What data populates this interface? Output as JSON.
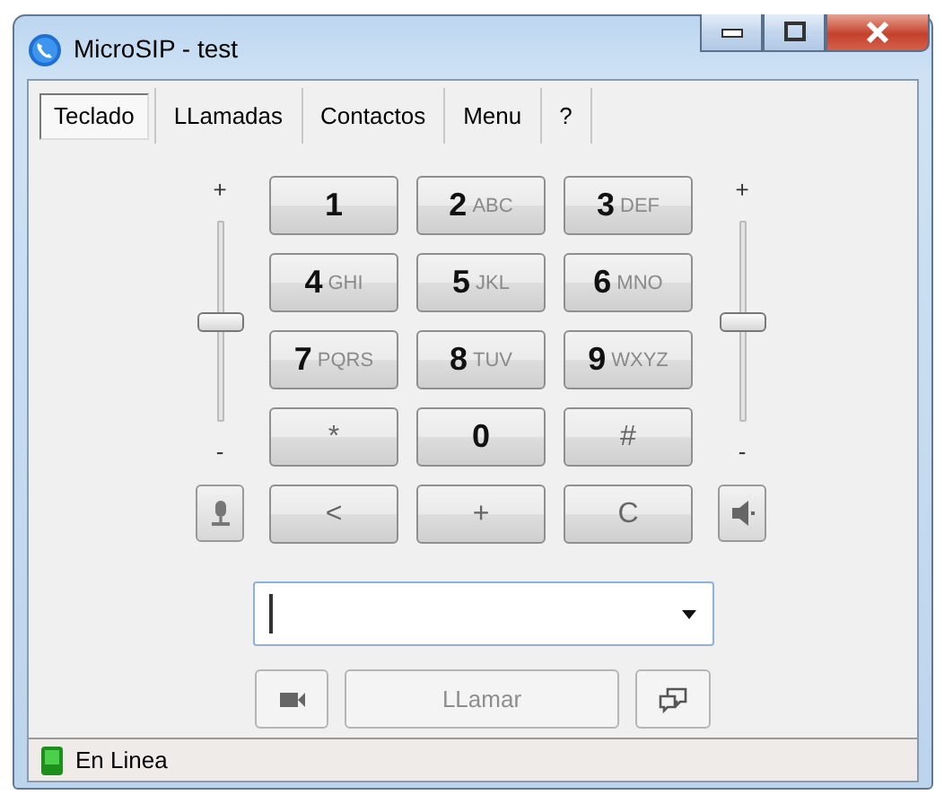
{
  "window": {
    "title": "MicroSIP - test"
  },
  "tabs": [
    {
      "label": "Teclado",
      "selected": true
    },
    {
      "label": "LLamadas",
      "selected": false
    },
    {
      "label": "Contactos",
      "selected": false
    },
    {
      "label": "Menu",
      "selected": false
    },
    {
      "label": "?",
      "selected": false
    }
  ],
  "keypad": [
    {
      "digit": "1"
    },
    {
      "digit": "2",
      "letters": "ABC"
    },
    {
      "digit": "3",
      "letters": "DEF"
    },
    {
      "digit": "4",
      "letters": "GHI"
    },
    {
      "digit": "5",
      "letters": "JKL"
    },
    {
      "digit": "6",
      "letters": "MNO"
    },
    {
      "digit": "7",
      "letters": "PQRS"
    },
    {
      "digit": "8",
      "letters": "TUV"
    },
    {
      "digit": "9",
      "letters": "WXYZ"
    },
    {
      "digit": "*",
      "kind": "symbol"
    },
    {
      "digit": "0"
    },
    {
      "digit": "#",
      "kind": "symbol"
    },
    {
      "digit": "<",
      "kind": "symbol"
    },
    {
      "digit": "+",
      "kind": "symbol"
    },
    {
      "digit": "C",
      "kind": "symbol"
    }
  ],
  "sliders": [
    {
      "kind": "microphone",
      "max_label": "+",
      "min_label": "-",
      "level": 0.5
    },
    {
      "kind": "speaker",
      "max_label": "+",
      "min_label": "-",
      "level": 0.5
    }
  ],
  "call_button": {
    "label": "LLamar",
    "disabled": true
  },
  "status_bar": {
    "text": "En Linea"
  }
}
